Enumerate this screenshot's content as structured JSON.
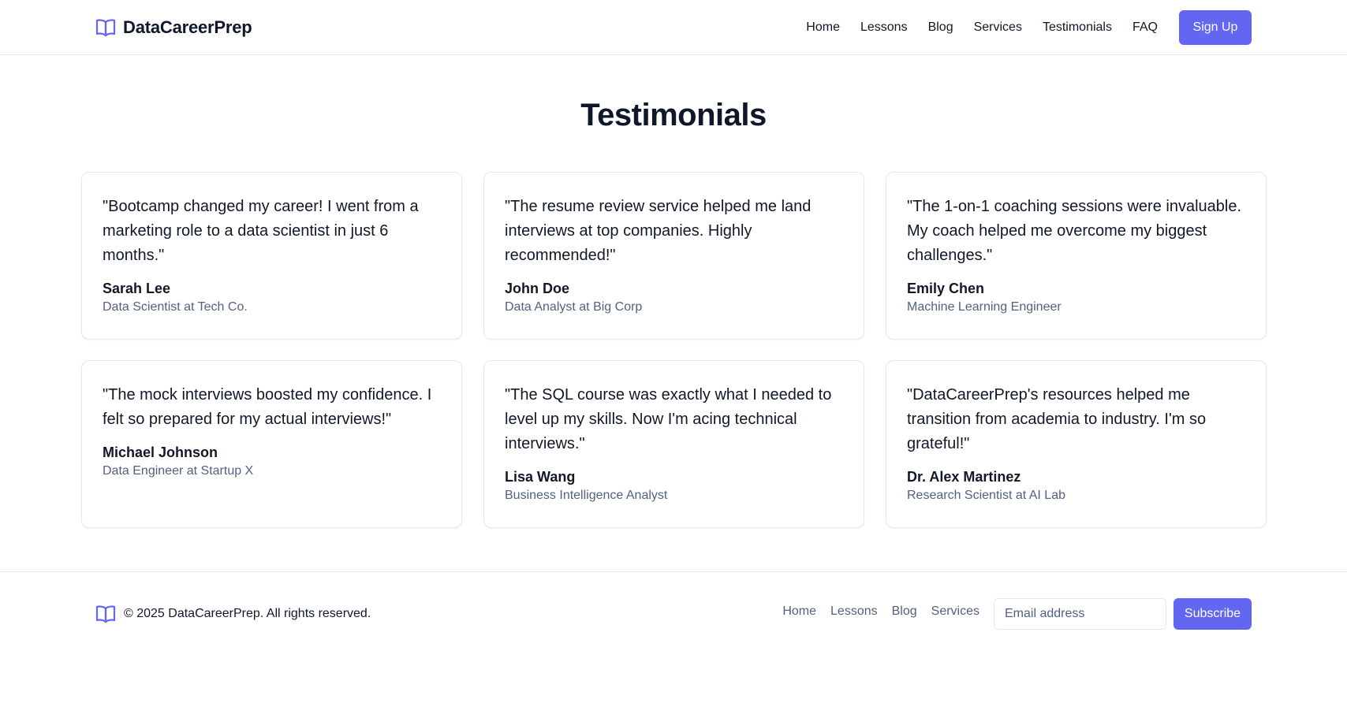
{
  "header": {
    "brand_icon": "open-book-icon",
    "brand_name": "DataCareerPrep",
    "nav": [
      "Home",
      "Lessons",
      "Blog",
      "Services",
      "Testimonials",
      "FAQ"
    ],
    "signup_label": "Sign Up"
  },
  "main": {
    "title": "Testimonials",
    "testimonials": [
      {
        "quote": "\"Bootcamp changed my career! I went from a marketing role to a data scientist in just 6 months.\"",
        "name": "Sarah Lee",
        "role": "Data Scientist at Tech Co."
      },
      {
        "quote": "\"The resume review service helped me land interviews at top companies. Highly recommended!\"",
        "name": "John Doe",
        "role": "Data Analyst at Big Corp"
      },
      {
        "quote": "\"The 1-on-1 coaching sessions were invaluable. My coach helped me overcome my biggest challenges.\"",
        "name": "Emily Chen",
        "role": "Machine Learning Engineer"
      },
      {
        "quote": "\"The mock interviews boosted my confidence. I felt so prepared for my actual interviews!\"",
        "name": "Michael Johnson",
        "role": "Data Engineer at Startup X"
      },
      {
        "quote": "\"The SQL course was exactly what I needed to level up my skills. Now I'm acing technical interviews.\"",
        "name": "Lisa Wang",
        "role": "Business Intelligence Analyst"
      },
      {
        "quote": "\"DataCareerPrep's resources helped me transition from academia to industry. I'm so grateful!\"",
        "name": "Dr. Alex Martinez",
        "role": "Research Scientist at AI Lab"
      }
    ]
  },
  "footer": {
    "brand_icon": "open-book-icon",
    "copyright": "© 2025 DataCareerPrep. All rights reserved.",
    "nav": [
      "Home",
      "Lessons",
      "Blog",
      "Services"
    ],
    "email_placeholder": "Email address",
    "subscribe_label": "Subscribe"
  },
  "colors": {
    "accent": "#6366f1",
    "text": "#0f172a",
    "muted": "#526180",
    "border": "#e5e7eb"
  }
}
